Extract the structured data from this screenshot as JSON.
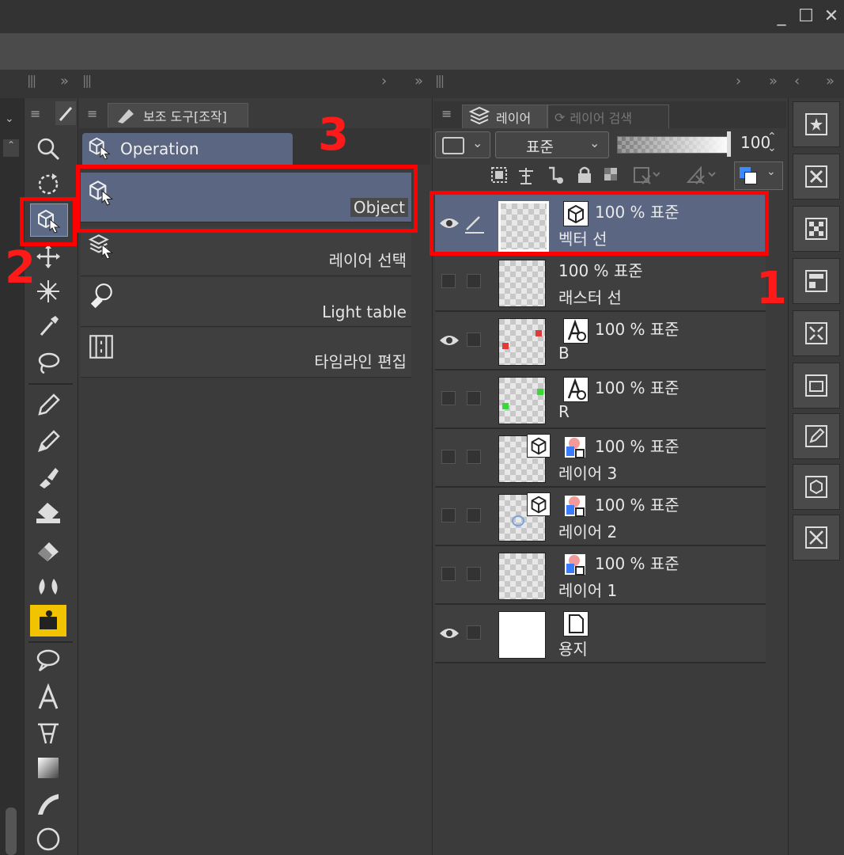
{
  "window": {
    "minimize": "_",
    "maximize": "☐",
    "close": "✕"
  },
  "subtool_panel": {
    "tab_label": "보조 도구[조작]",
    "group_tab": "Operation",
    "items": [
      {
        "label": "Object",
        "selected": true
      },
      {
        "label": "레이어 선택",
        "selected": false
      },
      {
        "label": "Light table",
        "selected": false
      },
      {
        "label": "타임라인 편집",
        "selected": false
      }
    ]
  },
  "layer_panel": {
    "tab_layer": "레이어",
    "tab_search": "레이어 검색",
    "blend_mode": "표준",
    "opacity": "100",
    "layers": [
      {
        "props": "100 % 표준",
        "name": "벡터 선",
        "visible": true,
        "selected": true,
        "editing": true
      },
      {
        "props": "100 % 표준",
        "name": "래스터 선",
        "visible": false,
        "selected": false
      },
      {
        "props": "100 % 표준",
        "name": "B",
        "visible": true,
        "selected": false
      },
      {
        "props": "100 % 표준",
        "name": "R",
        "visible": false,
        "selected": false
      },
      {
        "props": "100 % 표준",
        "name": "레이어 3",
        "visible": false,
        "selected": false
      },
      {
        "props": "100 % 표준",
        "name": "레이어 2",
        "visible": false,
        "selected": false
      },
      {
        "props": "100 % 표준",
        "name": "레이어 1",
        "visible": false,
        "selected": false
      },
      {
        "props": "",
        "name": "용지",
        "visible": true,
        "selected": false
      }
    ]
  },
  "annotations": {
    "n1": "1",
    "n2": "2",
    "n3": "3"
  },
  "colors": {
    "selection": "#5a6682",
    "annotation": "#ff0000",
    "accent_tool": "#f2c400"
  }
}
